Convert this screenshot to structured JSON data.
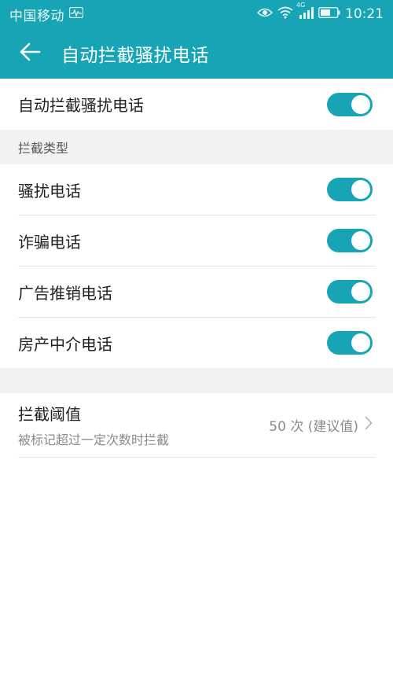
{
  "status_bar": {
    "carrier": "中国移动",
    "network": "4G",
    "time": "10:21"
  },
  "app_bar": {
    "title": "自动拦截骚扰电话"
  },
  "main_toggle": {
    "label": "自动拦截骚扰电话",
    "on": true
  },
  "intercept_types": {
    "header": "拦截类型",
    "items": [
      {
        "label": "骚扰电话",
        "on": true
      },
      {
        "label": "诈骗电话",
        "on": true
      },
      {
        "label": "广告推销电话",
        "on": true
      },
      {
        "label": "房产中介电话",
        "on": true
      }
    ]
  },
  "threshold": {
    "title": "拦截阈值",
    "subtitle": "被标记超过一定次数时拦截",
    "value": "50 次 (建议值)"
  },
  "colors": {
    "accent": "#17a5b5",
    "section_bg": "#f2f2f2",
    "secondary_text": "#8a8a8a"
  }
}
